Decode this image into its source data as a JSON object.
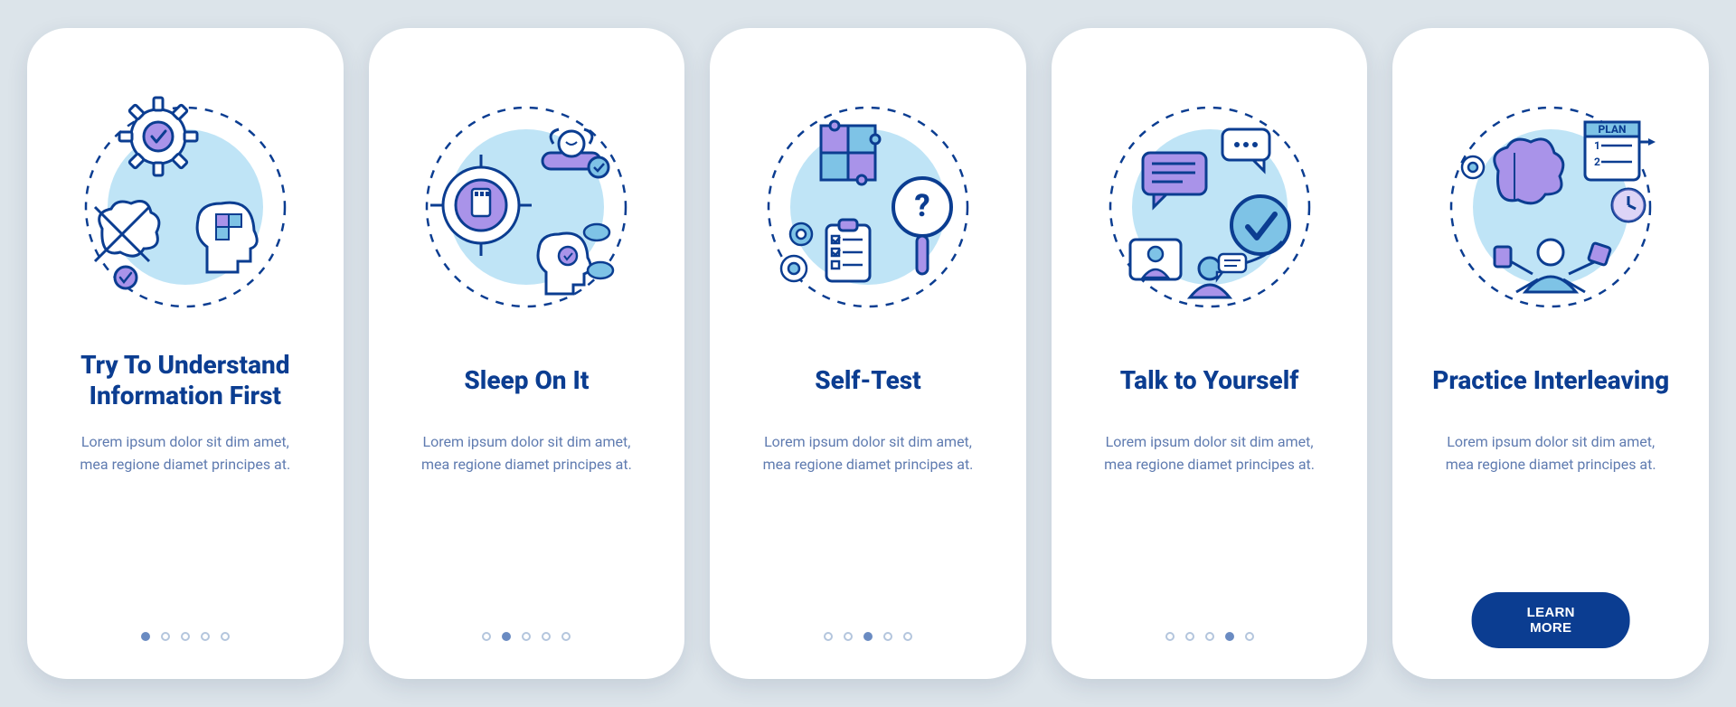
{
  "colors": {
    "brand": "#0b3d91",
    "accent": "#a993e9",
    "light": "#bfe4f6",
    "mid": "#7ec3e6"
  },
  "cards": [
    {
      "icon": "understand-icon",
      "title": "Try To Understand Information First",
      "desc": "Lorem ipsum dolor sit dim amet, mea regione diamet principes at.",
      "step": 1,
      "total": 5,
      "cta": null
    },
    {
      "icon": "sleep-icon",
      "title": "Sleep On It",
      "desc": "Lorem ipsum dolor sit dim amet, mea regione diamet principes at.",
      "step": 2,
      "total": 5,
      "cta": null
    },
    {
      "icon": "self-test-icon",
      "title": "Self-Test",
      "desc": "Lorem ipsum dolor sit dim amet, mea regione diamet principes at.",
      "step": 3,
      "total": 5,
      "cta": null
    },
    {
      "icon": "talk-icon",
      "title": "Talk to Yourself",
      "desc": "Lorem ipsum dolor sit dim amet, mea regione diamet principes at.",
      "step": 4,
      "total": 5,
      "cta": null
    },
    {
      "icon": "interleave-icon",
      "title": "Practice Interleaving",
      "desc": "Lorem ipsum dolor sit dim amet, mea regione diamet principes at.",
      "step": 5,
      "total": 5,
      "cta": "LEARN MORE"
    }
  ]
}
